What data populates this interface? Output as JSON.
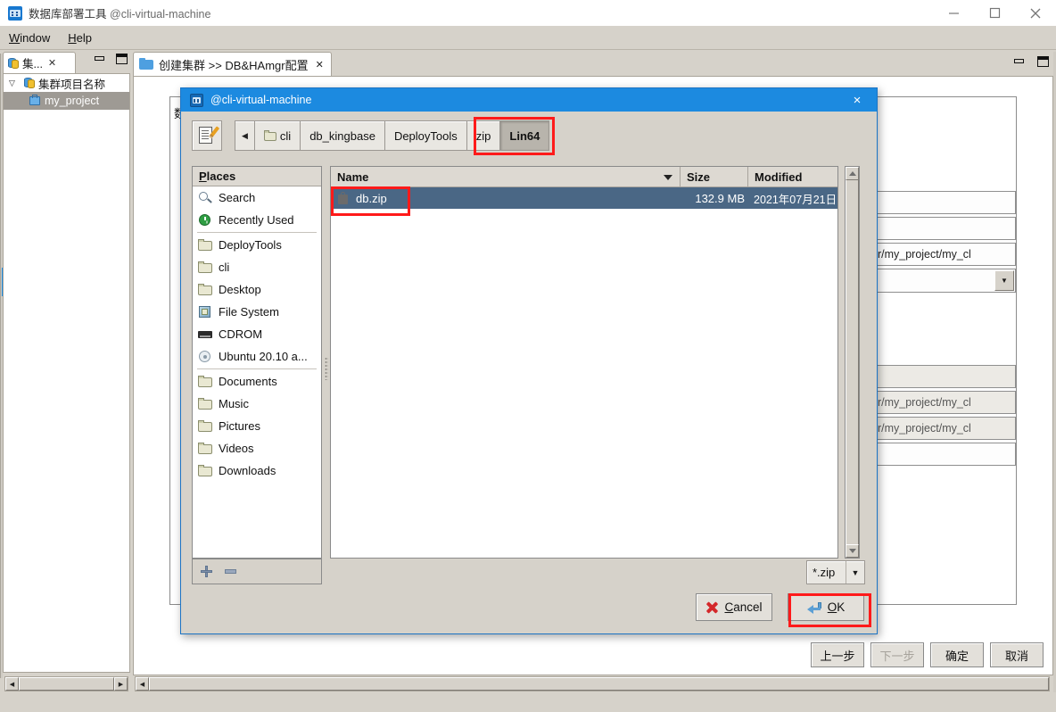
{
  "window": {
    "icon": "app-icon",
    "title": "数据库部署工具",
    "host": "@cli-virtual-machine",
    "minimize": "−",
    "maximize": "□",
    "close": "×"
  },
  "menubar": {
    "items": [
      {
        "label": "Window",
        "mnemonic": "W"
      },
      {
        "label": "Help",
        "mnemonic": "H"
      }
    ]
  },
  "left_panel": {
    "tab": {
      "label": "集...",
      "close": "✕"
    },
    "panel_buttons": {
      "minimize": "minimize-icon",
      "maximize": "maximize-icon"
    },
    "tree": {
      "root": {
        "label": "集群项目名称",
        "twisty": "▽"
      },
      "children": [
        {
          "label": "my_project",
          "selected": true
        }
      ]
    }
  },
  "main_panel": {
    "tab": {
      "label": "创建集群 >> DB&HAmgr配置",
      "close": "✕"
    },
    "panel_buttons": {
      "minimize": "minimize-icon",
      "maximize": "maximize-icon"
    },
    "background_form": {
      "fields": [
        {
          "value": ""
        },
        {
          "value": ""
        },
        {
          "value": "er/my_project/my_cl",
          "readonly": false
        },
        {
          "value": "",
          "type": "combo"
        },
        {
          "value": "",
          "readonly": true
        },
        {
          "value": "er/my_project/my_cl",
          "readonly": true
        },
        {
          "value": "er/my_project/my_cl",
          "readonly": true
        },
        {
          "value": ""
        }
      ],
      "obscured_label": "数"
    },
    "wizard_buttons": [
      {
        "label": "上一步",
        "enabled": true
      },
      {
        "label": "下一步",
        "enabled": false
      },
      {
        "label": "确定",
        "enabled": true
      },
      {
        "label": "取消",
        "enabled": true
      }
    ]
  },
  "file_dialog": {
    "title": "@cli-virtual-machine",
    "title_icon": "app-icon",
    "close": "×",
    "toolbar": {
      "type_filename_button": "pencil-document-icon",
      "back_button": "◀"
    },
    "breadcrumbs": [
      {
        "label": "cli",
        "icon": "folder-icon",
        "active": false
      },
      {
        "label": "db_kingbase",
        "active": false
      },
      {
        "label": "DeployTools",
        "active": false
      },
      {
        "label": "zip",
        "active": false
      },
      {
        "label": "Lin64",
        "active": true
      }
    ],
    "places": {
      "header": "Places",
      "header_mnemonic": "P",
      "items": [
        {
          "label": "Search",
          "icon": "search-icon"
        },
        {
          "label": "Recently Used",
          "icon": "recent-icon"
        },
        {
          "label": "DeployTools",
          "icon": "folder-icon"
        },
        {
          "label": "cli",
          "icon": "folder-icon"
        },
        {
          "label": "Desktop",
          "icon": "folder-icon"
        },
        {
          "label": "File System",
          "icon": "hard-disk-icon"
        },
        {
          "label": "CDROM",
          "icon": "cdrom-icon"
        },
        {
          "label": "Ubuntu 20.10 a...",
          "icon": "disc-icon"
        },
        {
          "label": "Documents",
          "icon": "folder-icon"
        },
        {
          "label": "Music",
          "icon": "folder-icon"
        },
        {
          "label": "Pictures",
          "icon": "folder-icon"
        },
        {
          "label": "Videos",
          "icon": "folder-icon"
        },
        {
          "label": "Downloads",
          "icon": "folder-icon"
        }
      ],
      "footer": {
        "add": "plus-icon",
        "remove": "minus-icon"
      }
    },
    "file_list": {
      "columns": [
        "Name",
        "Size",
        "Modified"
      ],
      "sort": {
        "column": "Name",
        "direction": "descending"
      },
      "rows": [
        {
          "name": "db.zip",
          "icon": "archive-icon",
          "size": "132.9 MB",
          "modified": "2021年07月21日",
          "selected": true
        }
      ]
    },
    "filter": {
      "value": "*.zip",
      "arrow": "▼"
    },
    "buttons": [
      {
        "label": "Cancel",
        "mnemonic": "C",
        "icon": "red-x-icon"
      },
      {
        "label": "OK",
        "mnemonic": "O",
        "icon": "enter-arrow-icon"
      }
    ]
  },
  "annotations": [
    {
      "name": "breadcrumb-zip-lin64-highlight",
      "color": "#ff1a1a"
    },
    {
      "name": "selected-file-highlight",
      "color": "#ff1a1a"
    },
    {
      "name": "ok-button-highlight",
      "color": "#ff1a1a"
    }
  ],
  "colors": {
    "accent_blue": "#1c8ae0",
    "selection_blue": "#4a6785",
    "annotation_red": "#ff1a1a",
    "chrome_gray": "#d6d2ca"
  }
}
